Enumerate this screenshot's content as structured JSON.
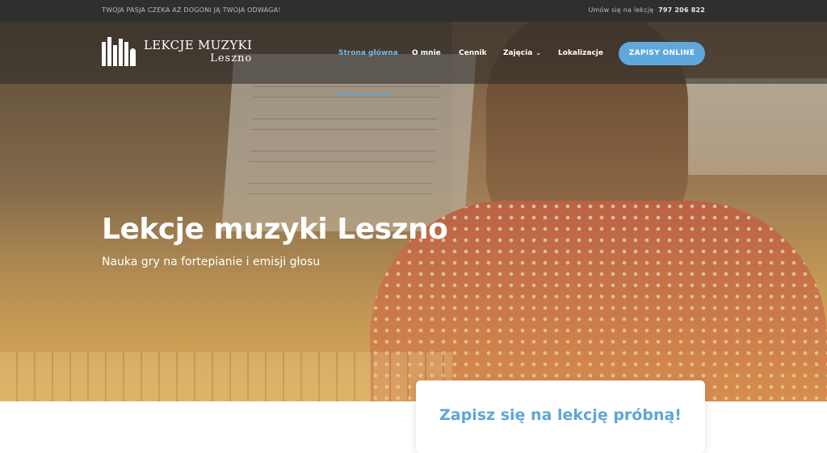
{
  "topbar": {
    "tagline": "TWOJA PASJA CZEKA AŻ DOGONI JĄ TWOJA ODWAGA!",
    "phone_label": "Umów się na lekcję",
    "phone_number": "797 206 822"
  },
  "logo": {
    "line1": "LEKCJE MUZYKI",
    "line2": "Leszno"
  },
  "nav": {
    "items": [
      {
        "label": "Strona główna",
        "active": true
      },
      {
        "label": "O mnie"
      },
      {
        "label": "Cennik"
      },
      {
        "label": "Zajęcia",
        "has_dropdown": true
      },
      {
        "label": "Lokalizacje"
      }
    ],
    "cta": "ZAPISY ONLINE"
  },
  "hero": {
    "title": "Lekcje muzyki Leszno",
    "subtitle": "Nauka gry na fortepianie i emisji głosu"
  },
  "card": {
    "title": "Zapisz się na lekcję próbną!"
  },
  "colors": {
    "accent": "#5fa8dd",
    "topbar": "#2f2f2f",
    "card_title": "#5ea6d8"
  }
}
